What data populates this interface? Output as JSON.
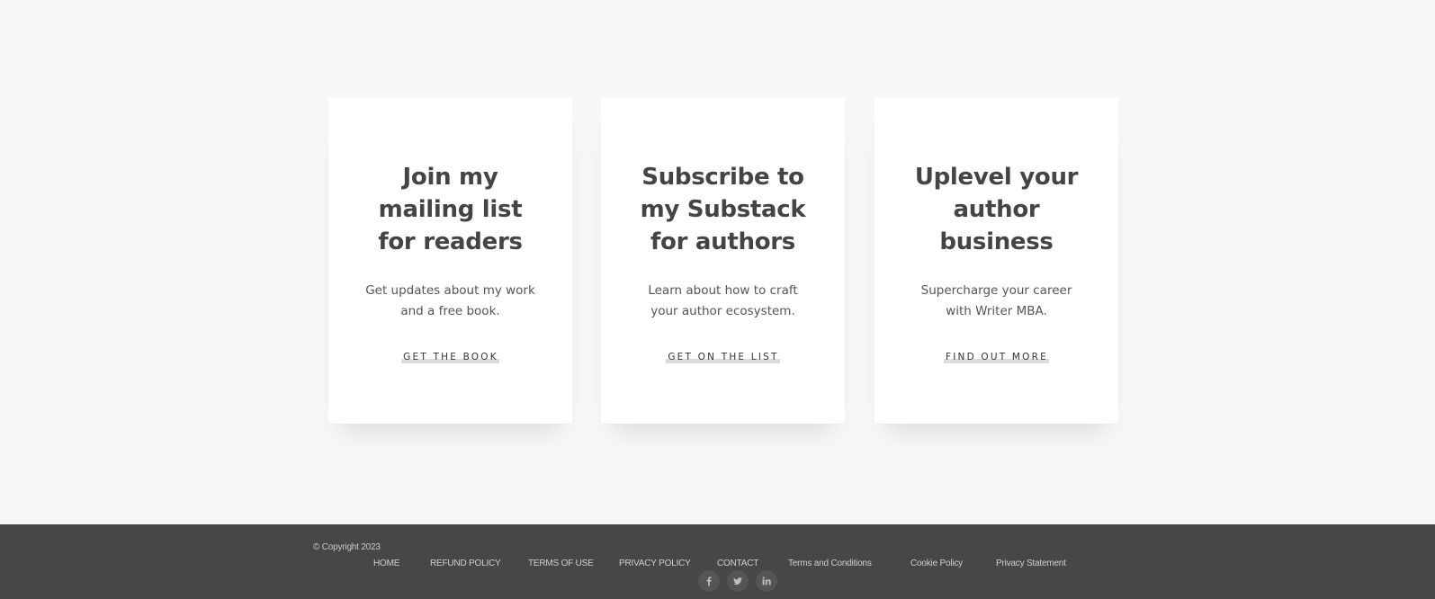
{
  "cards": [
    {
      "title_lines": [
        "Join my",
        "mailing list",
        "for readers"
      ],
      "text_lines": [
        "Get updates about my work",
        "and a free book."
      ],
      "link_label": "GET THE BOOK"
    },
    {
      "title_lines": [
        "Subscribe to",
        "my Substack",
        "for authors"
      ],
      "text_lines": [
        "Learn about how to craft",
        "your author ecosystem."
      ],
      "link_label": "GET ON THE LIST"
    },
    {
      "title_lines": [
        "Uplevel your",
        "author",
        "business"
      ],
      "text_lines": [
        "Supercharge your career",
        "with Writer MBA."
      ],
      "link_label": "FIND OUT MORE"
    }
  ],
  "footer": {
    "copyright": "© Copyright 2023",
    "nav": [
      "HOME",
      "REFUND POLICY",
      "TERMS OF USE",
      "PRIVACY POLICY",
      "CONTACT",
      "Terms and Conditions",
      "Cookie Policy",
      "Privacy Statement"
    ],
    "social_icons": [
      "facebook-icon",
      "twitter-icon",
      "linkedin-icon"
    ]
  },
  "colors": {
    "page_background": "#f7f7f7",
    "card_background": "#ffffff",
    "heading": "#444444",
    "footer_background": "#474747",
    "link_highlight": "#dcdcdc"
  }
}
